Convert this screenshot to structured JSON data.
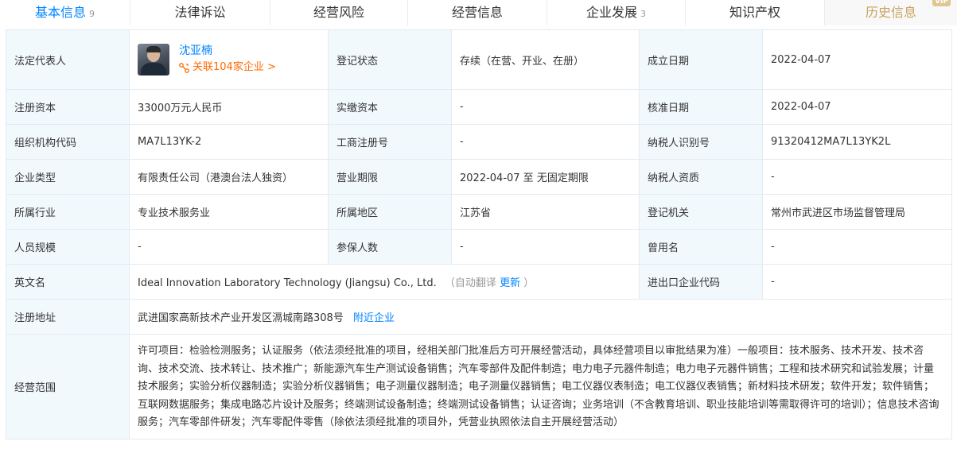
{
  "tabs": [
    {
      "label": "基本信息",
      "count": "9"
    },
    {
      "label": "法律诉讼",
      "count": ""
    },
    {
      "label": "经营风险",
      "count": ""
    },
    {
      "label": "经营信息",
      "count": ""
    },
    {
      "label": "企业发展",
      "count": "3"
    },
    {
      "label": "知识产权",
      "count": ""
    },
    {
      "label": "历史信息",
      "count": "",
      "badge": "VIP"
    }
  ],
  "table": {
    "legal_rep": {
      "label": "法定代表人",
      "name": "沈亚楠",
      "link": "关联104家企业 >"
    },
    "reg_status": {
      "label": "登记状态",
      "value": "存续（在营、开业、在册）"
    },
    "found_date": {
      "label": "成立日期",
      "value": "2022-04-07"
    },
    "reg_capital": {
      "label": "注册资本",
      "value": "33000万元人民币"
    },
    "paid_capital": {
      "label": "实缴资本",
      "value": "-"
    },
    "approve_date": {
      "label": "核准日期",
      "value": "2022-04-07"
    },
    "org_code": {
      "label": "组织机构代码",
      "value": "MA7L13YK-2"
    },
    "biz_reg_no": {
      "label": "工商注册号",
      "value": "-"
    },
    "tax_id": {
      "label": "纳税人识别号",
      "value": "91320412MA7L13YK2L"
    },
    "company_type": {
      "label": "企业类型",
      "value": "有限责任公司（港澳台法人独资）"
    },
    "biz_term": {
      "label": "营业期限",
      "value": "2022-04-07 至 无固定期限"
    },
    "tax_quali": {
      "label": "纳税人资质",
      "value": "-"
    },
    "industry": {
      "label": "所属行业",
      "value": "专业技术服务业"
    },
    "region": {
      "label": "所属地区",
      "value": "江苏省"
    },
    "reg_authority": {
      "label": "登记机关",
      "value": "常州市武进区市场监督管理局"
    },
    "staff_size": {
      "label": "人员规模",
      "value": "-"
    },
    "insured": {
      "label": "参保人数",
      "value": "-"
    },
    "former_name": {
      "label": "曾用名",
      "value": "-"
    },
    "english_name": {
      "label": "英文名",
      "value": "Ideal Innovation Laboratory Technology (Jiangsu) Co., Ltd.",
      "auto_translate": "（自动翻译",
      "update": "更新",
      "close_paren": "）"
    },
    "ie_code": {
      "label": "进出口企业代码",
      "value": "-"
    },
    "reg_address": {
      "label": "注册地址",
      "value": "武进国家高新技术产业开发区滆城南路308号",
      "nearby": "附近企业"
    },
    "biz_scope": {
      "label": "经营范围",
      "value": "许可项目：检验检测服务；认证服务（依法须经批准的项目，经相关部门批准后方可开展经营活动，具体经营项目以审批结果为准）一般项目：技术服务、技术开发、技术咨询、技术交流、技术转让、技术推广；新能源汽车生产测试设备销售；汽车零部件及配件制造；电力电子元器件制造；电力电子元器件销售；工程和技术研究和试验发展；计量技术服务；实验分析仪器制造；实验分析仪器销售；电子测量仪器制造；电子测量仪器销售；电工仪器仪表制造；电工仪器仪表销售；新材料技术研发；软件开发；软件销售；互联网数据服务；集成电路芯片设计及服务；终端测试设备制造；终端测试设备销售；认证咨询；业务培训（不含教育培训、职业技能培训等需取得许可的培训）；信息技术咨询服务；汽车零部件研发；汽车零配件零售（除依法须经批准的项目外，凭营业执照依法自主开展经营活动）"
    }
  }
}
